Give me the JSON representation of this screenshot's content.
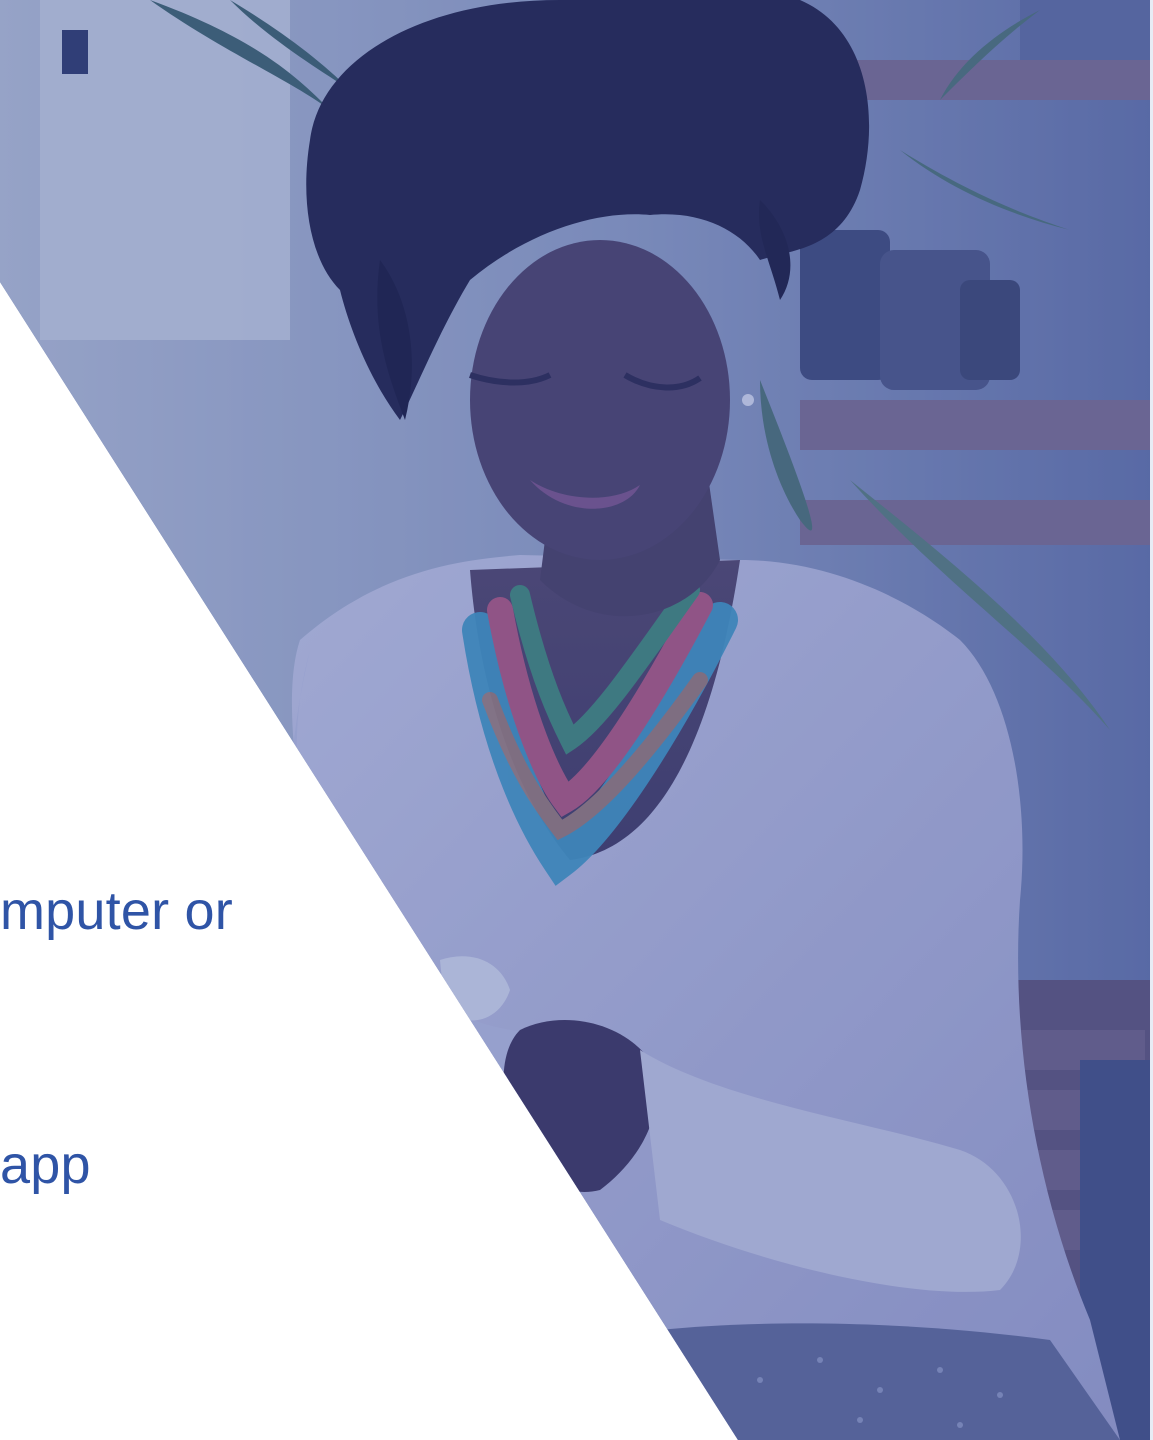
{
  "slide": {
    "background_image": {
      "description_icon": "woman-with-phone-photo",
      "tint_color": "#3f5a9f"
    },
    "text_lines": [
      {
        "text": "mputer or"
      },
      {
        "text": "app"
      }
    ],
    "colors": {
      "text": "#2f54a6",
      "background": "#ffffff",
      "photo_overlay": "#3f5a9f"
    }
  }
}
